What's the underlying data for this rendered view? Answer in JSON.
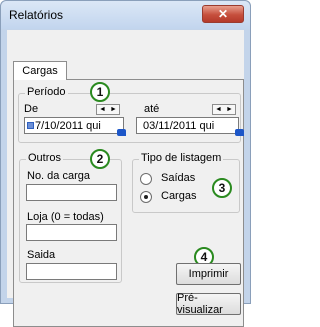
{
  "window": {
    "title": "Relatórios",
    "close_symbol": "✕"
  },
  "tabs": [
    {
      "label": "Cargas",
      "selected": true
    }
  ],
  "periodo": {
    "label": "Período",
    "from_label": "De",
    "to_label": "até",
    "from_value": "7/10/2011 qui",
    "to_value": "03/11/2011 qui",
    "spin_left": "◄",
    "spin_right": "►"
  },
  "outros": {
    "label": "Outros",
    "carga_label": "No. da carga",
    "carga_value": "",
    "loja_label": "Loja (0 = todas)",
    "loja_value": "",
    "saida_label": "Saida",
    "saida_value": ""
  },
  "tipo_listagem": {
    "label": "Tipo de listagem",
    "options": [
      {
        "label": "Saídas",
        "selected": false
      },
      {
        "label": "Cargas",
        "selected": true
      }
    ]
  },
  "buttons": {
    "imprimir": "Imprimir",
    "pre_visualizar": "Pré-visualizar"
  },
  "badges": [
    "1",
    "2",
    "3",
    "4"
  ],
  "colors": {
    "badge_border": "#2a8a1f",
    "title_bar": "#c2d5ee",
    "close_button": "#c64f3d"
  }
}
